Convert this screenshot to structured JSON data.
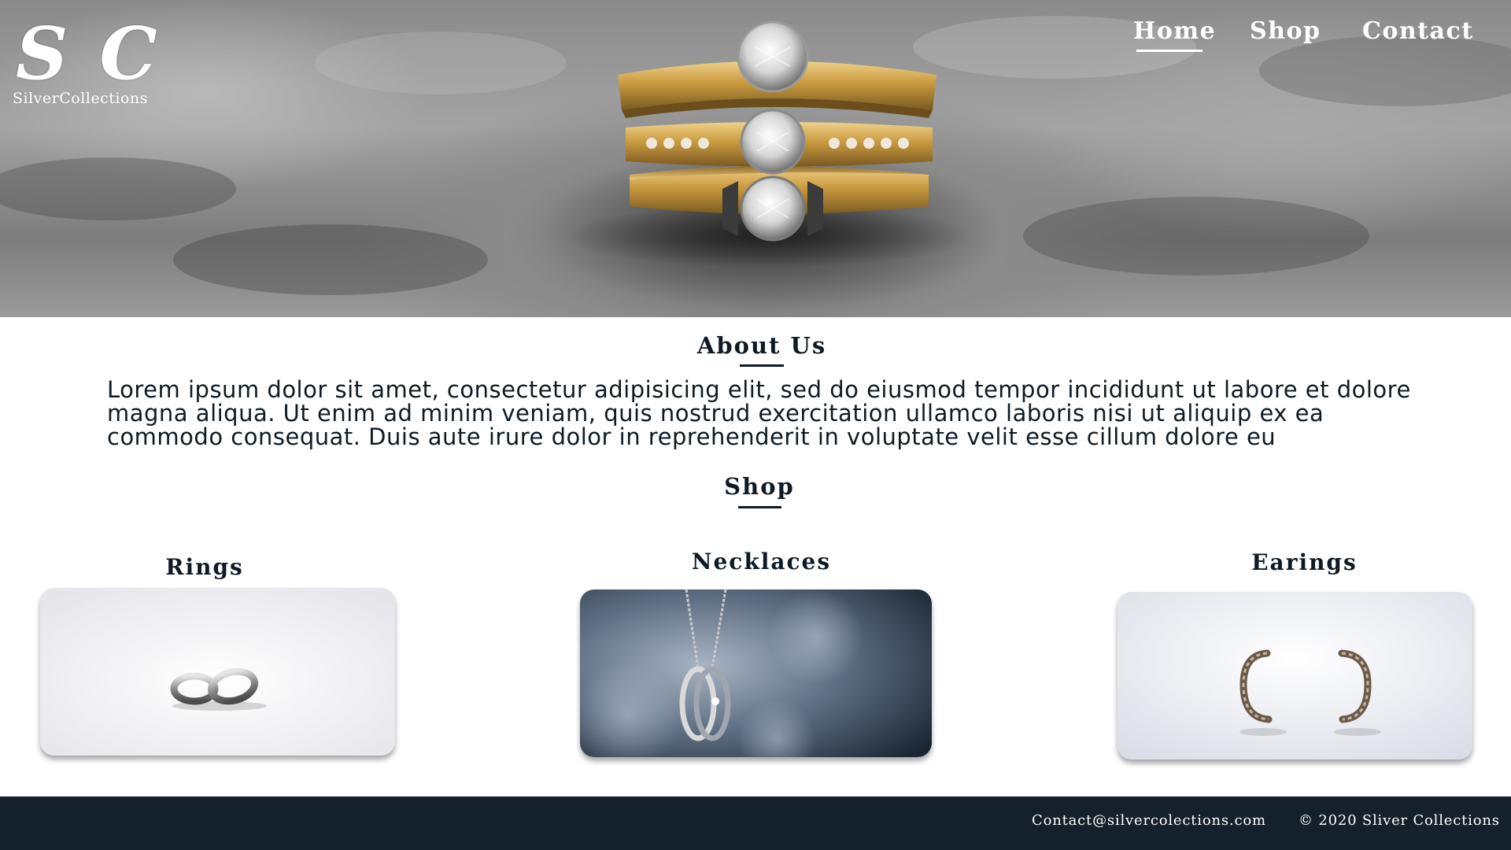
{
  "brand": {
    "logo_letters": [
      "S",
      "C"
    ],
    "name": "SilverCollections"
  },
  "nav": {
    "items": [
      {
        "label": "Home",
        "active": true
      },
      {
        "label": "Shop",
        "active": false
      },
      {
        "label": "Contact",
        "active": false
      }
    ]
  },
  "hero": {
    "image": "stacked-gold-rings-with-diamonds"
  },
  "about": {
    "title": "About Us",
    "text": "Lorem ipsum dolor sit amet, consectetur adipisicing elit, sed do eiusmod tempor incididunt ut labore et dolore magna aliqua. Ut enim ad minim veniam, quis nostrud exercitation ullamco laboris nisi ut aliquip ex ea commodo consequat. Duis aute irure dolor in reprehenderit in voluptate velit esse cillum dolore eu"
  },
  "shop": {
    "title": "Shop",
    "categories": [
      {
        "label": "Rings",
        "image": "silver-ring-pair"
      },
      {
        "label": "Necklaces",
        "image": "ring-pendant-necklace"
      },
      {
        "label": "Earings",
        "image": "hoop-earrings"
      }
    ]
  },
  "footer": {
    "email": "Contact@silvercolections.com",
    "copyright": "© 2020 Sliver Collections"
  },
  "colors": {
    "footer_bg": "#14202b",
    "text_dark": "#0f1a24",
    "nav_text": "#ffffff"
  }
}
